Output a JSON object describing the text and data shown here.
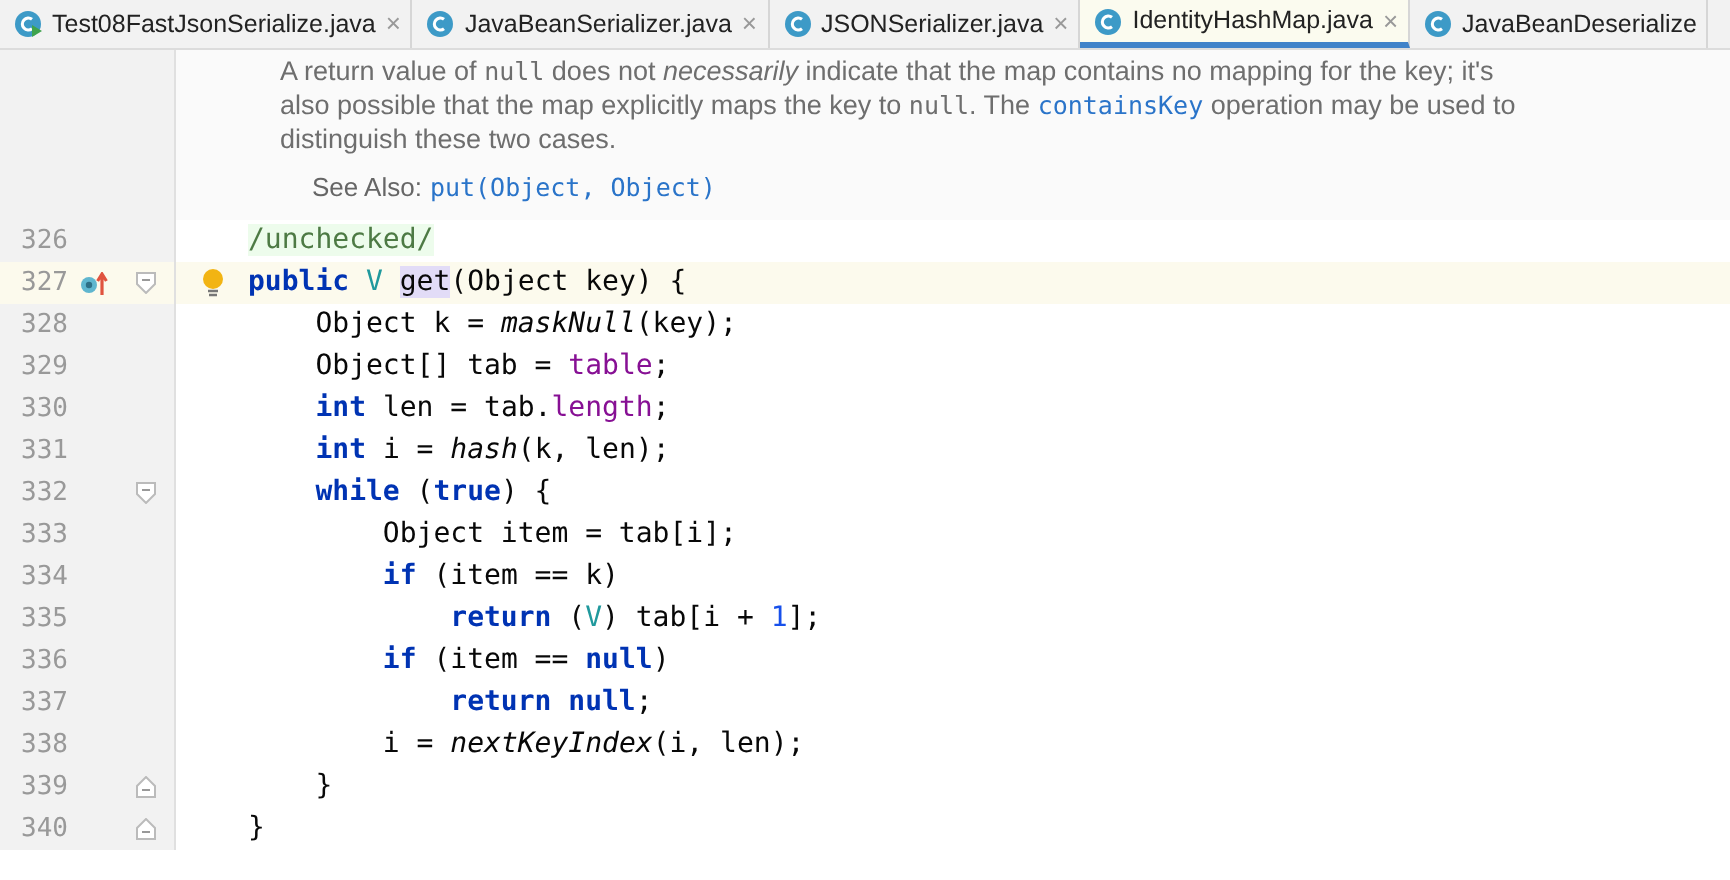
{
  "tabs": [
    {
      "label": "Test08FastJsonSerialize.java",
      "selected": false,
      "runnable": true
    },
    {
      "label": "JavaBeanSerializer.java",
      "selected": false,
      "runnable": false
    },
    {
      "label": "JSONSerializer.java",
      "selected": false,
      "runnable": false
    },
    {
      "label": "IdentityHashMap.java",
      "selected": true,
      "runnable": false
    },
    {
      "label": "JavaBeanDeserialize",
      "selected": false,
      "runnable": false
    }
  ],
  "tab_close": "×",
  "doc": {
    "paragraph": [
      {
        "kind": "text",
        "text": "A return value of "
      },
      {
        "kind": "code",
        "text": "null"
      },
      {
        "kind": "text",
        "text": " does not "
      },
      {
        "kind": "italic",
        "text": "necessarily"
      },
      {
        "kind": "text",
        "text": " indicate that the map contains no mapping for the key; it's also possible that the map explicitly maps the key to "
      },
      {
        "kind": "code",
        "text": "null"
      },
      {
        "kind": "text",
        "text": ". The "
      },
      {
        "kind": "link",
        "text": "containsKey"
      },
      {
        "kind": "text",
        "text": " operation may be used to distinguish these two cases."
      }
    ],
    "see_also_label": "See Also:",
    "see_also_link": "put(Object, Object)"
  },
  "lines": [
    {
      "number": "326",
      "current": false,
      "tokens": [
        {
          "kind": "annotation",
          "text": "/unchecked/"
        }
      ]
    },
    {
      "number": "327",
      "current": true,
      "override": true,
      "bulb": true,
      "fold_open": true,
      "tokens": [
        {
          "kind": "keyword",
          "text": "public"
        },
        {
          "kind": "typeparam",
          "text": " V "
        },
        {
          "kind": "usage",
          "text": "get"
        },
        {
          "kind": "plain",
          "text": "(Object key) {"
        }
      ]
    },
    {
      "number": "328",
      "current": false,
      "tokens": [
        {
          "kind": "plain",
          "text": "    Object k = "
        },
        {
          "kind": "static",
          "text": "maskNull"
        },
        {
          "kind": "plain",
          "text": "(key);"
        }
      ]
    },
    {
      "number": "329",
      "current": false,
      "tokens": [
        {
          "kind": "plain",
          "text": "    Object[] tab = "
        },
        {
          "kind": "field",
          "text": "table"
        },
        {
          "kind": "plain",
          "text": ";"
        }
      ]
    },
    {
      "number": "330",
      "current": false,
      "tokens": [
        {
          "kind": "keyword",
          "text": "    int"
        },
        {
          "kind": "plain",
          "text": " len = tab."
        },
        {
          "kind": "field",
          "text": "length"
        },
        {
          "kind": "plain",
          "text": ";"
        }
      ]
    },
    {
      "number": "331",
      "current": false,
      "tokens": [
        {
          "kind": "keyword",
          "text": "    int"
        },
        {
          "kind": "plain",
          "text": " i = "
        },
        {
          "kind": "static",
          "text": "hash"
        },
        {
          "kind": "plain",
          "text": "(k, len);"
        }
      ]
    },
    {
      "number": "332",
      "current": false,
      "fold_open": true,
      "tokens": [
        {
          "kind": "keyword",
          "text": "    while"
        },
        {
          "kind": "plain",
          "text": " ("
        },
        {
          "kind": "keyword",
          "text": "true"
        },
        {
          "kind": "plain",
          "text": ") {"
        }
      ]
    },
    {
      "number": "333",
      "current": false,
      "tokens": [
        {
          "kind": "plain",
          "text": "        Object item = tab[i];"
        }
      ]
    },
    {
      "number": "334",
      "current": false,
      "tokens": [
        {
          "kind": "keyword",
          "text": "        if"
        },
        {
          "kind": "plain",
          "text": " (item == k)"
        }
      ]
    },
    {
      "number": "335",
      "current": false,
      "tokens": [
        {
          "kind": "keyword",
          "text": "            return"
        },
        {
          "kind": "plain",
          "text": " ("
        },
        {
          "kind": "typeparam",
          "text": "V"
        },
        {
          "kind": "plain",
          "text": ") tab[i + "
        },
        {
          "kind": "number",
          "text": "1"
        },
        {
          "kind": "plain",
          "text": "];"
        }
      ]
    },
    {
      "number": "336",
      "current": false,
      "tokens": [
        {
          "kind": "keyword",
          "text": "        if"
        },
        {
          "kind": "plain",
          "text": " (item == "
        },
        {
          "kind": "keyword",
          "text": "null"
        },
        {
          "kind": "plain",
          "text": ")"
        }
      ]
    },
    {
      "number": "337",
      "current": false,
      "tokens": [
        {
          "kind": "keyword",
          "text": "            return null"
        },
        {
          "kind": "plain",
          "text": ";"
        }
      ]
    },
    {
      "number": "338",
      "current": false,
      "tokens": [
        {
          "kind": "plain",
          "text": "        i = "
        },
        {
          "kind": "static",
          "text": "nextKeyIndex"
        },
        {
          "kind": "plain",
          "text": "(i, len);"
        }
      ]
    },
    {
      "number": "339",
      "current": false,
      "fold_close": true,
      "tokens": [
        {
          "kind": "plain",
          "text": "    }"
        }
      ]
    },
    {
      "number": "340",
      "current": false,
      "fold_close": true,
      "tokens": [
        {
          "kind": "plain",
          "text": "}"
        }
      ]
    }
  ]
}
